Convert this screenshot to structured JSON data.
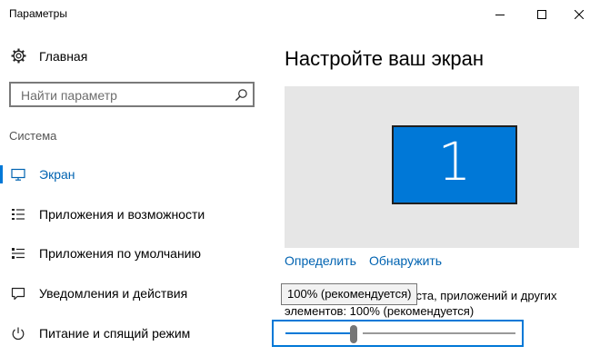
{
  "window": {
    "title": "Параметры",
    "controls": {
      "minimize": "minimize-icon",
      "maximize": "maximize-icon",
      "close": "close-icon"
    }
  },
  "sidebar": {
    "home_label": "Главная",
    "home_icon": "gear-icon",
    "search": {
      "placeholder": "Найти параметр",
      "icon": "search-icon"
    },
    "section_title": "Система",
    "items": [
      {
        "label": "Экран",
        "icon": "monitor-icon",
        "active": true
      },
      {
        "label": "Приложения и возможности",
        "icon": "apps-list-icon",
        "active": false
      },
      {
        "label": "Приложения по умолчанию",
        "icon": "default-apps-icon",
        "active": false
      },
      {
        "label": "Уведомления и действия",
        "icon": "notification-icon",
        "active": false
      },
      {
        "label": "Питание и спящий режим",
        "icon": "power-icon",
        "active": false
      }
    ]
  },
  "main": {
    "title": "Настройте ваш экран",
    "display_number": "1",
    "links": {
      "identify": "Определить",
      "detect": "Обнаружить"
    },
    "scale_text": "Изменение размера текста, приложений и других элементов: 100% (рекомендуется)",
    "tooltip": "100% (рекомендуется)",
    "slider": {
      "value_percent": 100,
      "position_fraction": 0.3
    }
  },
  "colors": {
    "accent": "#0078d7",
    "link": "#0063b1",
    "preview_bg": "#e6e6e6"
  }
}
